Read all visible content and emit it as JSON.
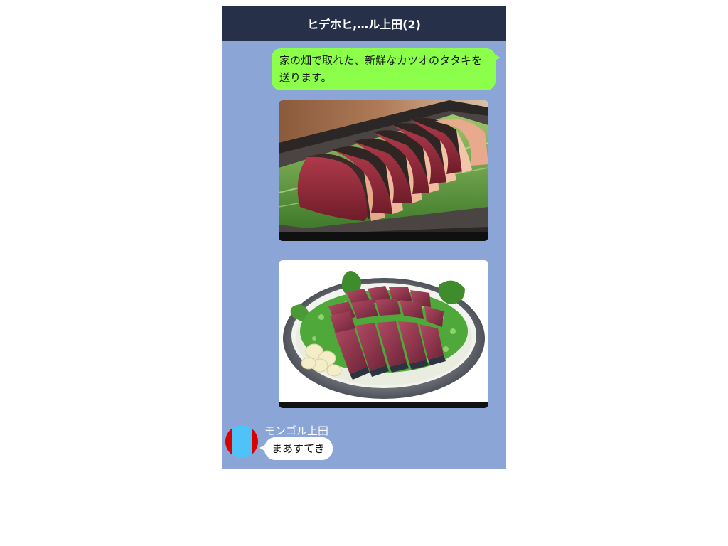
{
  "header": {
    "title": "ヒデホヒ,…ル上田(2)"
  },
  "messages": {
    "sent": {
      "text": "家の畑で取れた、新鮮なカツオのタタキを送ります。",
      "color": "#8bff4a"
    },
    "photos": [
      {
        "subject": "seared bonito tataki slices on leaf in dark dish"
      },
      {
        "subject": "seared bonito tataki on round plate with green onions and garlic"
      }
    ],
    "received": {
      "sender": "モンゴル上田",
      "text": "まあすてき"
    }
  },
  "colors": {
    "header_bg": "#263149",
    "chat_bg": "#8aa5d6",
    "sent_bubble": "#8bff4a",
    "received_bubble": "#ffffff"
  }
}
